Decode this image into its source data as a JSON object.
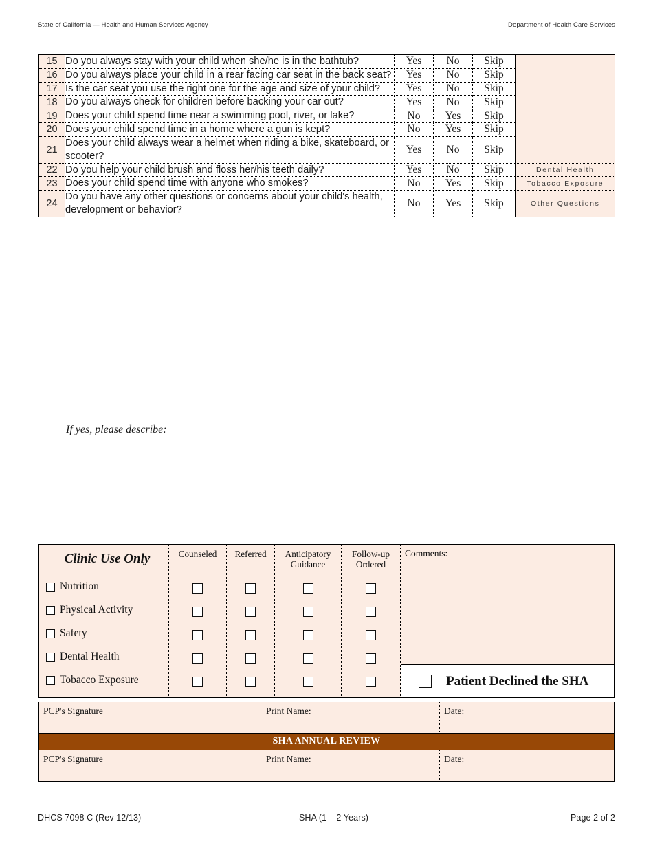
{
  "header": {
    "left": "State of California — Health and Human Services Agency",
    "right": "Department of Health Care Services"
  },
  "colors": {
    "peach_fill": "#fcece3",
    "banner_brown": "#984806",
    "rule_black": "#000000"
  },
  "questions": [
    {
      "num": "15",
      "text": "Do you always stay with your child when she/he is in the bathtub?",
      "a": "Yes",
      "b": "No",
      "c": "Skip",
      "category": ""
    },
    {
      "num": "16",
      "text": "Do you always place your child in a rear facing car seat in the back seat?",
      "a": "Yes",
      "b": "No",
      "c": "Skip",
      "category": ""
    },
    {
      "num": "17",
      "text": "Is the car seat you use the right one for the age and size of your child?",
      "a": "Yes",
      "b": "No",
      "c": "Skip",
      "category": ""
    },
    {
      "num": "18",
      "text": "Do you always check for children before backing your car out?",
      "a": "Yes",
      "b": "No",
      "c": "Skip",
      "category": ""
    },
    {
      "num": "19",
      "text": "Does your child spend time near a swimming pool, river, or lake?",
      "a": "No",
      "b": "Yes",
      "c": "Skip",
      "category": ""
    },
    {
      "num": "20",
      "text": "Does your child spend time in a home where a gun is kept?",
      "a": "No",
      "b": "Yes",
      "c": "Skip",
      "category": ""
    },
    {
      "num": "21",
      "text": "Does your child always wear a helmet when riding a bike, skateboard, or scooter?",
      "a": "Yes",
      "b": "No",
      "c": "Skip",
      "category": ""
    },
    {
      "num": "22",
      "text": "Do you help your child brush and floss her/his teeth daily?",
      "a": "Yes",
      "b": "No",
      "c": "Skip",
      "category": "Dental Health"
    },
    {
      "num": "23",
      "text": "Does your child spend time with anyone who smokes?",
      "a": "No",
      "b": "Yes",
      "c": "Skip",
      "category": "Tobacco Exposure"
    },
    {
      "num": "24",
      "text": "Do you have any other questions or concerns about your child's health, development or behavior?",
      "a": "No",
      "b": "Yes",
      "c": "Skip",
      "category": "Other Questions"
    }
  ],
  "if_yes_note": "If yes, please describe:",
  "clinic": {
    "title": "Clinic Use Only",
    "topics": [
      {
        "label": "Nutrition"
      },
      {
        "label": "Physical Activity"
      },
      {
        "label": "Safety"
      },
      {
        "label": "Dental Health"
      },
      {
        "label": "Tobacco Exposure"
      }
    ],
    "columns": [
      {
        "label": "Counseled"
      },
      {
        "label": "Referred"
      },
      {
        "label": "Anticipatory Guidance"
      },
      {
        "label": "Follow-up Ordered"
      }
    ],
    "comments_label": "Comments:",
    "declined_label": "Patient Declined the SHA"
  },
  "signatures": {
    "row1": {
      "signature": "PCP's Signature",
      "print_name": "Print Name:",
      "date": "Date:"
    },
    "annual_banner": "SHA ANNUAL REVIEW",
    "row2": {
      "signature": "PCP's Signature",
      "print_name": "Print Name:",
      "date": "Date:"
    }
  },
  "footer": {
    "form_id": "DHCS 7098 C (Rev 12/13)",
    "form_title": "SHA (1 – 2 Years)",
    "page": "Page 2 of 2"
  }
}
